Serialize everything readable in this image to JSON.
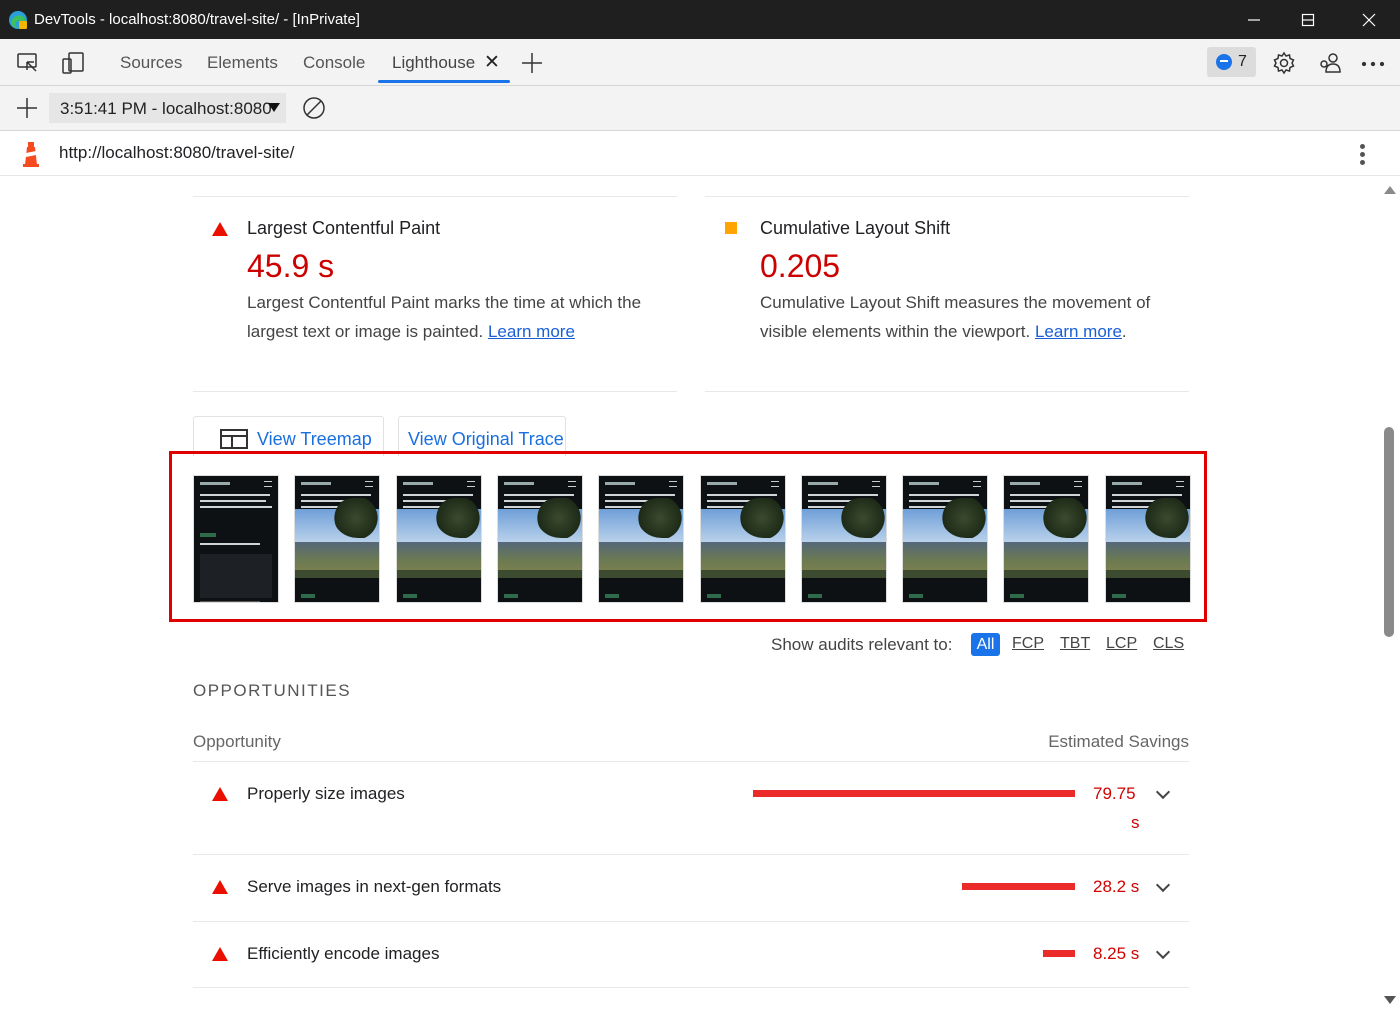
{
  "window": {
    "title": "DevTools - localhost:8080/travel-site/ - [InPrivate]"
  },
  "tabs": [
    {
      "label": "Sources"
    },
    {
      "label": "Elements"
    },
    {
      "label": "Console"
    },
    {
      "label": "Lighthouse",
      "active": true
    }
  ],
  "issues": {
    "count": "7"
  },
  "toolbar": {
    "report_label": "3:51:41 PM - localhost:8080"
  },
  "url": "http://localhost:8080/travel-site/",
  "metrics": [
    {
      "title": "Largest Contentful Paint",
      "value": "45.9 s",
      "desc": "Largest Contentful Paint marks the time at which the largest text or image is painted.",
      "learn_more": "Learn more",
      "status": "fail"
    },
    {
      "title": "Cumulative Layout Shift",
      "value": "0.205",
      "desc": "Cumulative Layout Shift measures the movement of visible elements within the viewport.",
      "learn_more": "Learn more",
      "status": "average"
    }
  ],
  "buttons": {
    "treemap": "View Treemap",
    "trace": "View Original Trace"
  },
  "filmstrip": {
    "frames": 10
  },
  "filter": {
    "label": "Show audits relevant to:",
    "options": [
      "All",
      "FCP",
      "TBT",
      "LCP",
      "CLS"
    ]
  },
  "opportunities": {
    "section_title": "OPPORTUNITIES",
    "col_opportunity": "Opportunity",
    "col_savings": "Estimated Savings",
    "items": [
      {
        "title": "Properly size images",
        "value": "79.75",
        "unit": "s",
        "bar_fraction": 1.0
      },
      {
        "title": "Serve images in next-gen formats",
        "value": "28.2 s",
        "bar_fraction": 0.35
      },
      {
        "title": "Efficiently encode images",
        "value": "8.25 s",
        "bar_fraction": 0.1
      }
    ]
  },
  "colors": {
    "fail": "#eb0f00",
    "average": "#ffa400",
    "accent": "#1a73e8",
    "highlight_box": "#e00000"
  }
}
